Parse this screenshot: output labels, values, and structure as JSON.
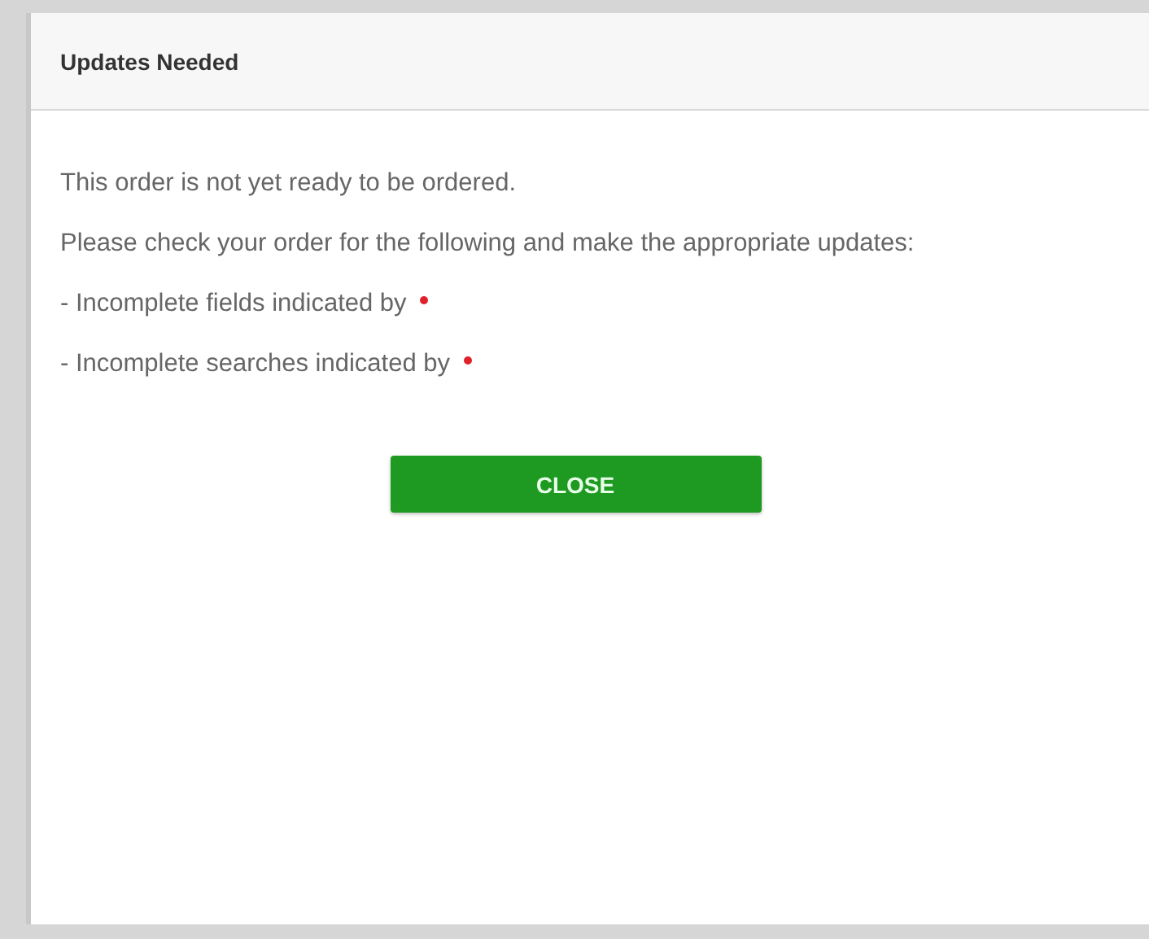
{
  "dialog": {
    "title": "Updates Needed",
    "paragraphs": [
      "This order is not yet ready to be ordered.",
      "Please check your order for the following and make the appropriate updates:"
    ],
    "items": [
      {
        "text": "- Incomplete fields indicated by",
        "required_marker": true
      },
      {
        "text": "- Incomplete searches indicated by",
        "required_marker": true
      }
    ],
    "button": "CLOSE"
  }
}
